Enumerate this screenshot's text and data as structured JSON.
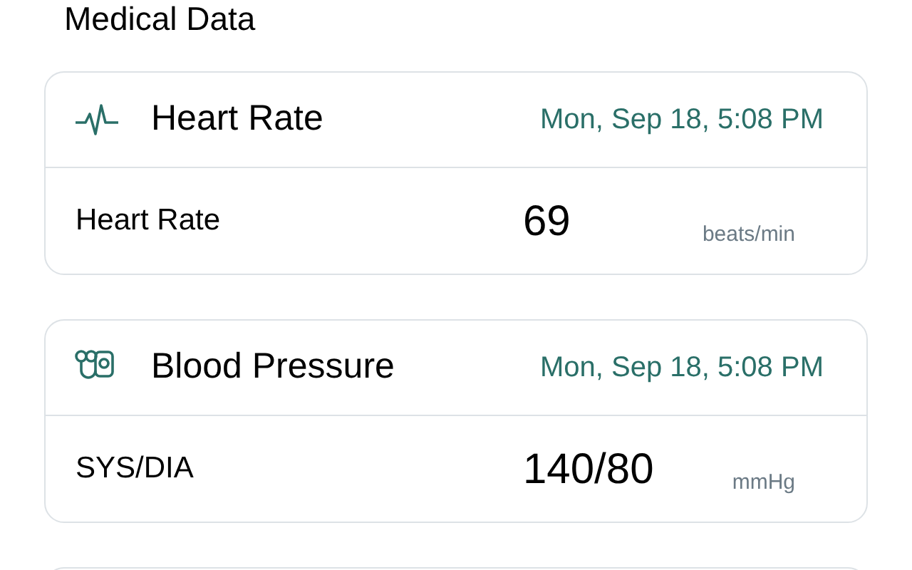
{
  "title": "Medical Data",
  "cards": [
    {
      "kind": "heart",
      "title": "Heart Rate",
      "time": "Mon, Sep 18, 5:08 PM",
      "label": "Heart Rate",
      "value": "69",
      "unit": "beats/min"
    },
    {
      "kind": "pressure",
      "title": "Blood Pressure",
      "time": "Mon, Sep 18, 5:08 PM",
      "label": "SYS/DIA",
      "value": "140/80",
      "unit": "mmHg"
    }
  ]
}
